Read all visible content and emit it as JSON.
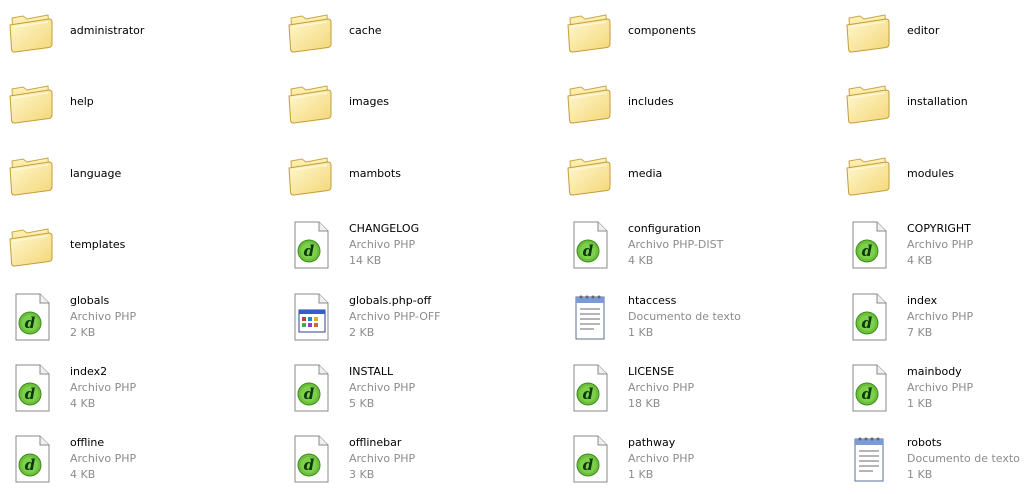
{
  "explorer": {
    "items": [
      {
        "name": "administrator",
        "kind": "folder"
      },
      {
        "name": "cache",
        "kind": "folder"
      },
      {
        "name": "components",
        "kind": "folder"
      },
      {
        "name": "editor",
        "kind": "folder"
      },
      {
        "name": "help",
        "kind": "folder"
      },
      {
        "name": "images",
        "kind": "folder"
      },
      {
        "name": "includes",
        "kind": "folder"
      },
      {
        "name": "installation",
        "kind": "folder"
      },
      {
        "name": "language",
        "kind": "folder"
      },
      {
        "name": "mambots",
        "kind": "folder"
      },
      {
        "name": "media",
        "kind": "folder"
      },
      {
        "name": "modules",
        "kind": "folder"
      },
      {
        "name": "templates",
        "kind": "folder"
      },
      {
        "name": "CHANGELOG",
        "kind": "php",
        "type": "Archivo PHP",
        "size": "14 KB"
      },
      {
        "name": "configuration",
        "kind": "php",
        "type": "Archivo PHP-DIST",
        "size": "4 KB"
      },
      {
        "name": "COPYRIGHT",
        "kind": "php",
        "type": "Archivo PHP",
        "size": "4 KB"
      },
      {
        "name": "globals",
        "kind": "php",
        "type": "Archivo PHP",
        "size": "2 KB"
      },
      {
        "name": "globals.php-off",
        "kind": "app",
        "type": "Archivo PHP-OFF",
        "size": "2 KB"
      },
      {
        "name": "htaccess",
        "kind": "text",
        "type": "Documento de texto",
        "size": "1 KB"
      },
      {
        "name": "index",
        "kind": "php",
        "type": "Archivo PHP",
        "size": "7 KB"
      },
      {
        "name": "index2",
        "kind": "php",
        "type": "Archivo PHP",
        "size": "4 KB"
      },
      {
        "name": "INSTALL",
        "kind": "php",
        "type": "Archivo PHP",
        "size": "5 KB"
      },
      {
        "name": "LICENSE",
        "kind": "php",
        "type": "Archivo PHP",
        "size": "18 KB"
      },
      {
        "name": "mainbody",
        "kind": "php",
        "type": "Archivo PHP",
        "size": "1 KB"
      },
      {
        "name": "offline",
        "kind": "php",
        "type": "Archivo PHP",
        "size": "4 KB"
      },
      {
        "name": "offlinebar",
        "kind": "php",
        "type": "Archivo PHP",
        "size": "3 KB"
      },
      {
        "name": "pathway",
        "kind": "php",
        "type": "Archivo PHP",
        "size": "1 KB"
      },
      {
        "name": "robots",
        "kind": "text",
        "type": "Documento de texto",
        "size": "1 KB"
      }
    ]
  },
  "icons": {
    "folder": "folder-icon",
    "php": "dreamweaver-php-file-icon",
    "app": "application-file-icon",
    "text": "text-document-icon"
  }
}
